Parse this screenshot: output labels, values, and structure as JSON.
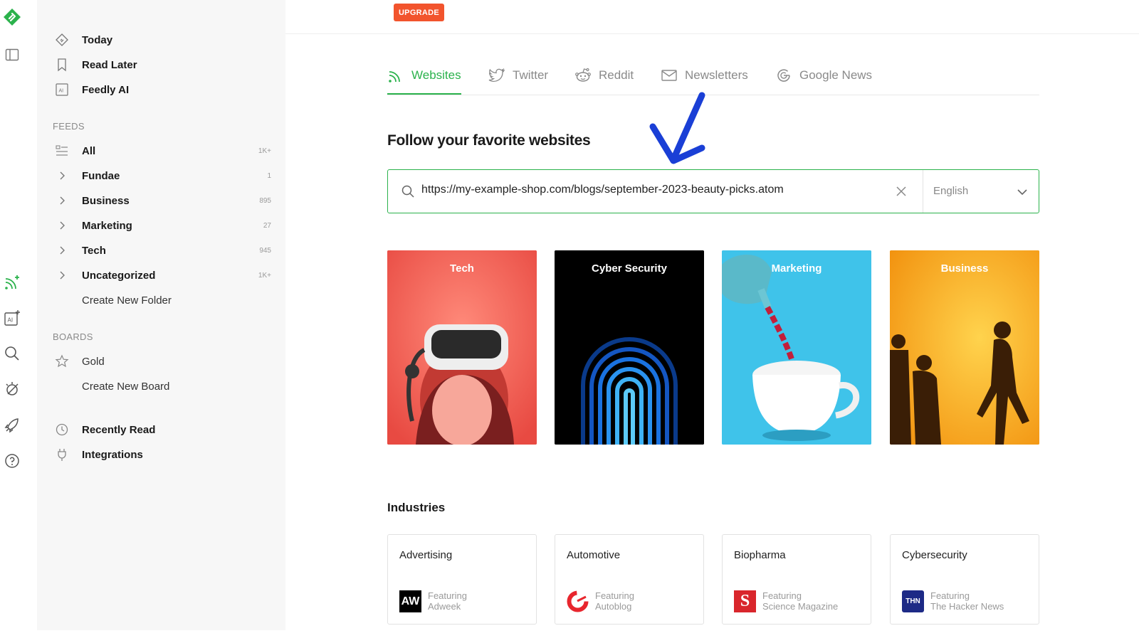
{
  "rail": {
    "icons": [
      "feedly-logo-icon",
      "sidebar-toggle-icon",
      "add-feed-icon",
      "ai-feed-icon",
      "search-icon",
      "hide-icon",
      "rocket-icon",
      "help-icon"
    ]
  },
  "sidebar": {
    "top_items": [
      {
        "label": "Today",
        "icon": "today-icon"
      },
      {
        "label": "Read Later",
        "icon": "bookmark-icon"
      },
      {
        "label": "Feedly AI",
        "icon": "ai-icon"
      }
    ],
    "feeds_header": "FEEDS",
    "feeds": [
      {
        "label": "All",
        "count": "1K+"
      },
      {
        "label": "Fundae",
        "count": "1"
      },
      {
        "label": "Business",
        "count": "895"
      },
      {
        "label": "Marketing",
        "count": "27"
      },
      {
        "label": "Tech",
        "count": "945"
      },
      {
        "label": "Uncategorized",
        "count": "1K+"
      }
    ],
    "create_folder": "Create New Folder",
    "boards_header": "BOARDS",
    "boards": [
      {
        "label": "Gold"
      }
    ],
    "create_board": "Create New Board",
    "bottom_items": [
      {
        "label": "Recently Read",
        "icon": "clock-icon"
      },
      {
        "label": "Integrations",
        "icon": "plug-icon"
      }
    ]
  },
  "topbar": {
    "upgrade_label": "UPGRADE"
  },
  "tabs": [
    {
      "label": "Websites",
      "icon": "rss-icon",
      "active": true
    },
    {
      "label": "Twitter",
      "icon": "twitter-icon",
      "active": false
    },
    {
      "label": "Reddit",
      "icon": "reddit-icon",
      "active": false
    },
    {
      "label": "Newsletters",
      "icon": "envelope-icon",
      "active": false
    },
    {
      "label": "Google News",
      "icon": "google-icon",
      "active": false
    }
  ],
  "follow": {
    "heading": "Follow your favorite websites",
    "search_value": "https://my-example-shop.com/blogs/september-2023-beauty-picks.atom",
    "language": "English"
  },
  "topic_cards": [
    {
      "title": "Tech",
      "color": "#f0574e"
    },
    {
      "title": "Cyber Security",
      "color": "#000000"
    },
    {
      "title": "Marketing",
      "color": "#3fc3ea"
    },
    {
      "title": "Business",
      "color": "#f7a51c"
    }
  ],
  "industries": {
    "heading": "Industries",
    "items": [
      {
        "name": "Advertising",
        "featuring": "Featuring",
        "source": "Adweek",
        "logo_text": "AW",
        "logo_color": "#000000"
      },
      {
        "name": "Automotive",
        "featuring": "Featuring",
        "source": "Autoblog",
        "logo_text": "",
        "logo_color": "#e8262e"
      },
      {
        "name": "Biopharma",
        "featuring": "Featuring",
        "source": "Science Magazine",
        "logo_text": "S",
        "logo_color": "#d9262c"
      },
      {
        "name": "Cybersecurity",
        "featuring": "Featuring",
        "source": "The Hacker News",
        "logo_text": "THN",
        "logo_color": "#1d2a86"
      }
    ]
  },
  "colors": {
    "accent": "#2bb24c",
    "upgrade": "#f2542d",
    "annotation_arrow": "#1a3fd6"
  }
}
